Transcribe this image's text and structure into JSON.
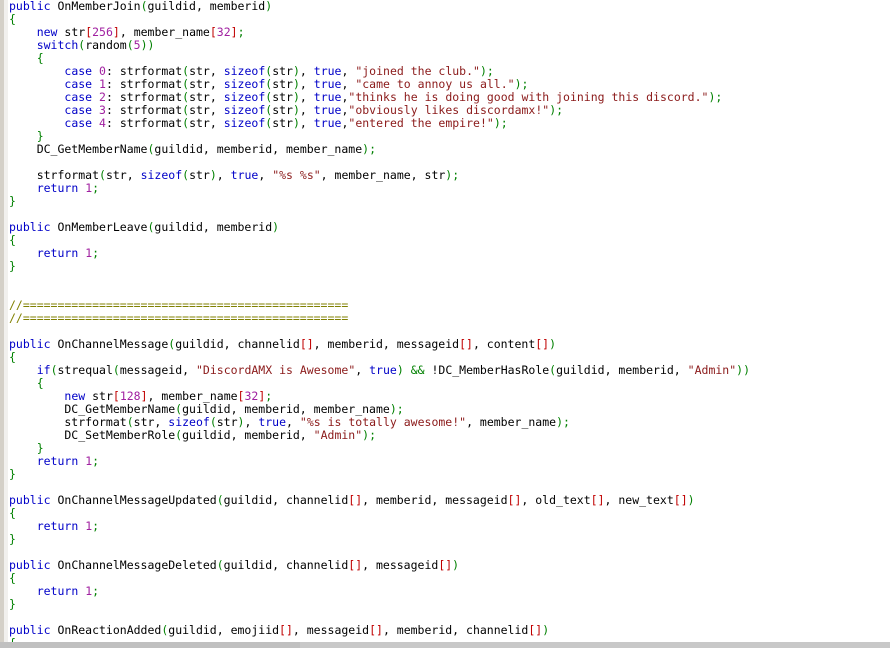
{
  "editor": {
    "language": "pawn",
    "gutter_visible": true,
    "scrollbar": {
      "orientation": "horizontal",
      "visible": true
    },
    "colors": {
      "background": "#ffffff",
      "gutter": "#d4d0c8",
      "keyword": "#0000c8",
      "identifier": "#000000",
      "number": "#a020a0",
      "string": "#8b1a1a",
      "bracket": "#c00000",
      "paren": "#008000",
      "comment": "#808000",
      "operator": "#008000",
      "scrollbar": "#c8c8c8"
    }
  },
  "code": {
    "lines": [
      [
        {
          "t": "public",
          "c": "kw"
        },
        {
          "t": " OnMemberJoin",
          "c": "id"
        },
        {
          "t": "(",
          "c": "par"
        },
        {
          "t": "guildid, memberid",
          "c": "id"
        },
        {
          "t": ")",
          "c": "par"
        }
      ],
      [
        {
          "t": "{",
          "c": "par"
        }
      ],
      [
        {
          "t": "    ",
          "c": "id"
        },
        {
          "t": "new",
          "c": "kw"
        },
        {
          "t": " str",
          "c": "id"
        },
        {
          "t": "[",
          "c": "brk"
        },
        {
          "t": "256",
          "c": "num"
        },
        {
          "t": "]",
          "c": "brk"
        },
        {
          "t": ", member_name",
          "c": "id"
        },
        {
          "t": "[",
          "c": "brk"
        },
        {
          "t": "32",
          "c": "num"
        },
        {
          "t": "]",
          "c": "brk"
        },
        {
          "t": ";",
          "c": "semi"
        }
      ],
      [
        {
          "t": "    ",
          "c": "id"
        },
        {
          "t": "switch",
          "c": "kw"
        },
        {
          "t": "(",
          "c": "par"
        },
        {
          "t": "random",
          "c": "id"
        },
        {
          "t": "(",
          "c": "par"
        },
        {
          "t": "5",
          "c": "num"
        },
        {
          "t": ")",
          "c": "par"
        },
        {
          "t": ")",
          "c": "par"
        }
      ],
      [
        {
          "t": "    ",
          "c": "id"
        },
        {
          "t": "{",
          "c": "par"
        }
      ],
      [
        {
          "t": "        ",
          "c": "id"
        },
        {
          "t": "case",
          "c": "kw"
        },
        {
          "t": " ",
          "c": "id"
        },
        {
          "t": "0",
          "c": "num"
        },
        {
          "t": ": strformat",
          "c": "id"
        },
        {
          "t": "(",
          "c": "par"
        },
        {
          "t": "str, ",
          "c": "id"
        },
        {
          "t": "sizeof",
          "c": "kw"
        },
        {
          "t": "(",
          "c": "par"
        },
        {
          "t": "str",
          "c": "id"
        },
        {
          "t": ")",
          "c": "par"
        },
        {
          "t": ", ",
          "c": "id"
        },
        {
          "t": "true",
          "c": "kw"
        },
        {
          "t": ", ",
          "c": "id"
        },
        {
          "t": "\"joined the club.\"",
          "c": "str"
        },
        {
          "t": ")",
          "c": "par"
        },
        {
          "t": ";",
          "c": "semi"
        }
      ],
      [
        {
          "t": "        ",
          "c": "id"
        },
        {
          "t": "case",
          "c": "kw"
        },
        {
          "t": " ",
          "c": "id"
        },
        {
          "t": "1",
          "c": "num"
        },
        {
          "t": ": strformat",
          "c": "id"
        },
        {
          "t": "(",
          "c": "par"
        },
        {
          "t": "str, ",
          "c": "id"
        },
        {
          "t": "sizeof",
          "c": "kw"
        },
        {
          "t": "(",
          "c": "par"
        },
        {
          "t": "str",
          "c": "id"
        },
        {
          "t": ")",
          "c": "par"
        },
        {
          "t": ", ",
          "c": "id"
        },
        {
          "t": "true",
          "c": "kw"
        },
        {
          "t": ", ",
          "c": "id"
        },
        {
          "t": "\"came to annoy us all.\"",
          "c": "str"
        },
        {
          "t": ")",
          "c": "par"
        },
        {
          "t": ";",
          "c": "semi"
        }
      ],
      [
        {
          "t": "        ",
          "c": "id"
        },
        {
          "t": "case",
          "c": "kw"
        },
        {
          "t": " ",
          "c": "id"
        },
        {
          "t": "2",
          "c": "num"
        },
        {
          "t": ": strformat",
          "c": "id"
        },
        {
          "t": "(",
          "c": "par"
        },
        {
          "t": "str, ",
          "c": "id"
        },
        {
          "t": "sizeof",
          "c": "kw"
        },
        {
          "t": "(",
          "c": "par"
        },
        {
          "t": "str",
          "c": "id"
        },
        {
          "t": ")",
          "c": "par"
        },
        {
          "t": ", ",
          "c": "id"
        },
        {
          "t": "true",
          "c": "kw"
        },
        {
          "t": ",",
          "c": "id"
        },
        {
          "t": "\"thinks he is doing good with joining this discord.\"",
          "c": "str"
        },
        {
          "t": ")",
          "c": "par"
        },
        {
          "t": ";",
          "c": "semi"
        }
      ],
      [
        {
          "t": "        ",
          "c": "id"
        },
        {
          "t": "case",
          "c": "kw"
        },
        {
          "t": " ",
          "c": "id"
        },
        {
          "t": "3",
          "c": "num"
        },
        {
          "t": ": strformat",
          "c": "id"
        },
        {
          "t": "(",
          "c": "par"
        },
        {
          "t": "str, ",
          "c": "id"
        },
        {
          "t": "sizeof",
          "c": "kw"
        },
        {
          "t": "(",
          "c": "par"
        },
        {
          "t": "str",
          "c": "id"
        },
        {
          "t": ")",
          "c": "par"
        },
        {
          "t": ", ",
          "c": "id"
        },
        {
          "t": "true",
          "c": "kw"
        },
        {
          "t": ",",
          "c": "id"
        },
        {
          "t": "\"obviously likes discordamx!\"",
          "c": "str"
        },
        {
          "t": ")",
          "c": "par"
        },
        {
          "t": ";",
          "c": "semi"
        }
      ],
      [
        {
          "t": "        ",
          "c": "id"
        },
        {
          "t": "case",
          "c": "kw"
        },
        {
          "t": " ",
          "c": "id"
        },
        {
          "t": "4",
          "c": "num"
        },
        {
          "t": ": strformat",
          "c": "id"
        },
        {
          "t": "(",
          "c": "par"
        },
        {
          "t": "str, ",
          "c": "id"
        },
        {
          "t": "sizeof",
          "c": "kw"
        },
        {
          "t": "(",
          "c": "par"
        },
        {
          "t": "str",
          "c": "id"
        },
        {
          "t": ")",
          "c": "par"
        },
        {
          "t": ", ",
          "c": "id"
        },
        {
          "t": "true",
          "c": "kw"
        },
        {
          "t": ",",
          "c": "id"
        },
        {
          "t": "\"entered the empire!\"",
          "c": "str"
        },
        {
          "t": ")",
          "c": "par"
        },
        {
          "t": ";",
          "c": "semi"
        }
      ],
      [
        {
          "t": "    ",
          "c": "id"
        },
        {
          "t": "}",
          "c": "par"
        }
      ],
      [
        {
          "t": "    DC_GetMemberName",
          "c": "id"
        },
        {
          "t": "(",
          "c": "par"
        },
        {
          "t": "guildid, memberid, member_name",
          "c": "id"
        },
        {
          "t": ")",
          "c": "par"
        },
        {
          "t": ";",
          "c": "semi"
        }
      ],
      [],
      [
        {
          "t": "    strformat",
          "c": "id"
        },
        {
          "t": "(",
          "c": "par"
        },
        {
          "t": "str, ",
          "c": "id"
        },
        {
          "t": "sizeof",
          "c": "kw"
        },
        {
          "t": "(",
          "c": "par"
        },
        {
          "t": "str",
          "c": "id"
        },
        {
          "t": ")",
          "c": "par"
        },
        {
          "t": ", ",
          "c": "id"
        },
        {
          "t": "true",
          "c": "kw"
        },
        {
          "t": ", ",
          "c": "id"
        },
        {
          "t": "\"%s %s\"",
          "c": "str"
        },
        {
          "t": ", member_name, str",
          "c": "id"
        },
        {
          "t": ")",
          "c": "par"
        },
        {
          "t": ";",
          "c": "semi"
        }
      ],
      [
        {
          "t": "    ",
          "c": "id"
        },
        {
          "t": "return",
          "c": "kw"
        },
        {
          "t": " ",
          "c": "id"
        },
        {
          "t": "1",
          "c": "num"
        },
        {
          "t": ";",
          "c": "semi"
        }
      ],
      [
        {
          "t": "}",
          "c": "par"
        }
      ],
      [],
      [
        {
          "t": "public",
          "c": "kw"
        },
        {
          "t": " OnMemberLeave",
          "c": "id"
        },
        {
          "t": "(",
          "c": "par"
        },
        {
          "t": "guildid, memberid",
          "c": "id"
        },
        {
          "t": ")",
          "c": "par"
        }
      ],
      [
        {
          "t": "{",
          "c": "par"
        }
      ],
      [
        {
          "t": "    ",
          "c": "id"
        },
        {
          "t": "return",
          "c": "kw"
        },
        {
          "t": " ",
          "c": "id"
        },
        {
          "t": "1",
          "c": "num"
        },
        {
          "t": ";",
          "c": "semi"
        }
      ],
      [
        {
          "t": "}",
          "c": "par"
        }
      ],
      [],
      [],
      [
        {
          "t": "//===============================================",
          "c": "cmt"
        }
      ],
      [
        {
          "t": "//===============================================",
          "c": "cmt"
        }
      ],
      [],
      [
        {
          "t": "public",
          "c": "kw"
        },
        {
          "t": " OnChannelMessage",
          "c": "id"
        },
        {
          "t": "(",
          "c": "par"
        },
        {
          "t": "guildid, channelid",
          "c": "id"
        },
        {
          "t": "[]",
          "c": "brk"
        },
        {
          "t": ", memberid, messageid",
          "c": "id"
        },
        {
          "t": "[]",
          "c": "brk"
        },
        {
          "t": ", content",
          "c": "id"
        },
        {
          "t": "[]",
          "c": "brk"
        },
        {
          "t": ")",
          "c": "par"
        }
      ],
      [
        {
          "t": "{",
          "c": "par"
        }
      ],
      [
        {
          "t": "    ",
          "c": "id"
        },
        {
          "t": "if",
          "c": "kw"
        },
        {
          "t": "(",
          "c": "par"
        },
        {
          "t": "strequal",
          "c": "id"
        },
        {
          "t": "(",
          "c": "par"
        },
        {
          "t": "messageid, ",
          "c": "id"
        },
        {
          "t": "\"DiscordAMX is Awesome\"",
          "c": "str"
        },
        {
          "t": ", ",
          "c": "id"
        },
        {
          "t": "true",
          "c": "kw"
        },
        {
          "t": ")",
          "c": "par"
        },
        {
          "t": " ",
          "c": "id"
        },
        {
          "t": "&&",
          "c": "op"
        },
        {
          "t": " !DC_MemberHasRole",
          "c": "id"
        },
        {
          "t": "(",
          "c": "par"
        },
        {
          "t": "guildid, memberid, ",
          "c": "id"
        },
        {
          "t": "\"Admin\"",
          "c": "str"
        },
        {
          "t": ")",
          "c": "par"
        },
        {
          "t": ")",
          "c": "par"
        }
      ],
      [
        {
          "t": "    ",
          "c": "id"
        },
        {
          "t": "{",
          "c": "par"
        }
      ],
      [
        {
          "t": "        ",
          "c": "id"
        },
        {
          "t": "new",
          "c": "kw"
        },
        {
          "t": " str",
          "c": "id"
        },
        {
          "t": "[",
          "c": "brk"
        },
        {
          "t": "128",
          "c": "num"
        },
        {
          "t": "]",
          "c": "brk"
        },
        {
          "t": ", member_name",
          "c": "id"
        },
        {
          "t": "[",
          "c": "brk"
        },
        {
          "t": "32",
          "c": "num"
        },
        {
          "t": "]",
          "c": "brk"
        },
        {
          "t": ";",
          "c": "semi"
        }
      ],
      [
        {
          "t": "        DC_GetMemberName",
          "c": "id"
        },
        {
          "t": "(",
          "c": "par"
        },
        {
          "t": "guildid, memberid, member_name",
          "c": "id"
        },
        {
          "t": ")",
          "c": "par"
        },
        {
          "t": ";",
          "c": "semi"
        }
      ],
      [
        {
          "t": "        strformat",
          "c": "id"
        },
        {
          "t": "(",
          "c": "par"
        },
        {
          "t": "str, ",
          "c": "id"
        },
        {
          "t": "sizeof",
          "c": "kw"
        },
        {
          "t": "(",
          "c": "par"
        },
        {
          "t": "str",
          "c": "id"
        },
        {
          "t": ")",
          "c": "par"
        },
        {
          "t": ", ",
          "c": "id"
        },
        {
          "t": "true",
          "c": "kw"
        },
        {
          "t": ", ",
          "c": "id"
        },
        {
          "t": "\"%s is totally awesome!\"",
          "c": "str"
        },
        {
          "t": ", member_name",
          "c": "id"
        },
        {
          "t": ")",
          "c": "par"
        },
        {
          "t": ";",
          "c": "semi"
        }
      ],
      [
        {
          "t": "        DC_SetMemberRole",
          "c": "id"
        },
        {
          "t": "(",
          "c": "par"
        },
        {
          "t": "guildid, memberid, ",
          "c": "id"
        },
        {
          "t": "\"Admin\"",
          "c": "str"
        },
        {
          "t": ")",
          "c": "par"
        },
        {
          "t": ";",
          "c": "semi"
        }
      ],
      [
        {
          "t": "    ",
          "c": "id"
        },
        {
          "t": "}",
          "c": "par"
        }
      ],
      [
        {
          "t": "    ",
          "c": "id"
        },
        {
          "t": "return",
          "c": "kw"
        },
        {
          "t": " ",
          "c": "id"
        },
        {
          "t": "1",
          "c": "num"
        },
        {
          "t": ";",
          "c": "semi"
        }
      ],
      [
        {
          "t": "}",
          "c": "par"
        }
      ],
      [],
      [
        {
          "t": "public",
          "c": "kw"
        },
        {
          "t": " OnChannelMessageUpdated",
          "c": "id"
        },
        {
          "t": "(",
          "c": "par"
        },
        {
          "t": "guildid, channelid",
          "c": "id"
        },
        {
          "t": "[]",
          "c": "brk"
        },
        {
          "t": ", memberid, messageid",
          "c": "id"
        },
        {
          "t": "[]",
          "c": "brk"
        },
        {
          "t": ", old_text",
          "c": "id"
        },
        {
          "t": "[]",
          "c": "brk"
        },
        {
          "t": ", new_text",
          "c": "id"
        },
        {
          "t": "[]",
          "c": "brk"
        },
        {
          "t": ")",
          "c": "par"
        }
      ],
      [
        {
          "t": "{",
          "c": "par"
        }
      ],
      [
        {
          "t": "    ",
          "c": "id"
        },
        {
          "t": "return",
          "c": "kw"
        },
        {
          "t": " ",
          "c": "id"
        },
        {
          "t": "1",
          "c": "num"
        },
        {
          "t": ";",
          "c": "semi"
        }
      ],
      [
        {
          "t": "}",
          "c": "par"
        }
      ],
      [],
      [
        {
          "t": "public",
          "c": "kw"
        },
        {
          "t": " OnChannelMessageDeleted",
          "c": "id"
        },
        {
          "t": "(",
          "c": "par"
        },
        {
          "t": "guildid, channelid",
          "c": "id"
        },
        {
          "t": "[]",
          "c": "brk"
        },
        {
          "t": ", messageid",
          "c": "id"
        },
        {
          "t": "[]",
          "c": "brk"
        },
        {
          "t": ")",
          "c": "par"
        }
      ],
      [
        {
          "t": "{",
          "c": "par"
        }
      ],
      [
        {
          "t": "    ",
          "c": "id"
        },
        {
          "t": "return",
          "c": "kw"
        },
        {
          "t": " ",
          "c": "id"
        },
        {
          "t": "1",
          "c": "num"
        },
        {
          "t": ";",
          "c": "semi"
        }
      ],
      [
        {
          "t": "}",
          "c": "par"
        }
      ],
      [],
      [
        {
          "t": "public",
          "c": "kw"
        },
        {
          "t": " OnReactionAdded",
          "c": "id"
        },
        {
          "t": "(",
          "c": "par"
        },
        {
          "t": "guildid, emojiid",
          "c": "id"
        },
        {
          "t": "[]",
          "c": "brk"
        },
        {
          "t": ", messageid",
          "c": "id"
        },
        {
          "t": "[]",
          "c": "brk"
        },
        {
          "t": ", memberid, channelid",
          "c": "id"
        },
        {
          "t": "[]",
          "c": "brk"
        },
        {
          "t": ")",
          "c": "par"
        }
      ],
      [
        {
          "t": "{",
          "c": "par"
        }
      ]
    ]
  }
}
